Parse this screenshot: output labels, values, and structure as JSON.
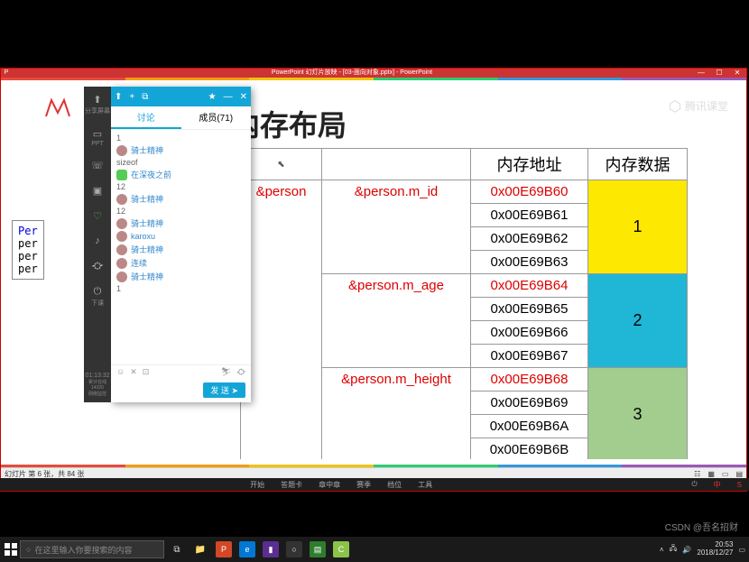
{
  "window": {
    "title": "PowerPoint 幻灯片放映 - [03-面向对象.pptx] - PowerPoint"
  },
  "slide": {
    "title": "内存布局",
    "watermark": "腾讯课堂",
    "snippet": {
      "l1a": "Per",
      "l2a": "per",
      "l3a": "per",
      "l4a": "per"
    }
  },
  "table": {
    "h_addr": "内存地址",
    "h_data": "内存数据",
    "person": "&person",
    "fields": [
      "&person.m_id",
      "&person.m_age",
      "&person.m_height"
    ],
    "addrs": [
      "0x00E69B60",
      "0x00E69B61",
      "0x00E69B62",
      "0x00E69B63",
      "0x00E69B64",
      "0x00E69B65",
      "0x00E69B66",
      "0x00E69B67",
      "0x00E69B68",
      "0x00E69B69",
      "0x00E69B6A",
      "0x00E69B6B"
    ],
    "vals": [
      "1",
      "2",
      "3"
    ],
    "cursor": "⬉"
  },
  "chat": {
    "tabs": {
      "share": "分享屏幕",
      "discuss": "讨论",
      "members": "成员(71)"
    },
    "messages": [
      {
        "n": "",
        "t": "1",
        "avatar": false
      },
      {
        "n": "骑士精神",
        "t": "",
        "avatar": true
      },
      {
        "n": "",
        "t": "sizeof",
        "avatar": false
      },
      {
        "n": "在深夜之前",
        "t": "",
        "avatar": true,
        "green": true
      },
      {
        "n": "",
        "t": "12",
        "avatar": false
      },
      {
        "n": "骑士精神",
        "t": "",
        "avatar": true
      },
      {
        "n": "",
        "t": "12",
        "avatar": false
      },
      {
        "n": "骑士精神",
        "t": "",
        "avatar": true
      },
      {
        "n": "karoxu",
        "t": "",
        "avatar": true
      },
      {
        "n": "骑士精神",
        "t": "",
        "avatar": true
      },
      {
        "n": "连续",
        "t": "",
        "avatar": true
      },
      {
        "n": "骑士精神",
        "t": "",
        "avatar": true
      },
      {
        "n": "",
        "t": "1",
        "avatar": false
      }
    ],
    "send": "发 送"
  },
  "sidebar": {
    "items": [
      "PPT",
      "语音",
      "视频",
      "录制",
      "音乐",
      "设置",
      "下课"
    ],
    "time": "01:13:32",
    "sub": "累计在线\n14320\n网络监控"
  },
  "status": {
    "left": "幻灯片 第 6 张，共 84 张"
  },
  "menu": {
    "items": [
      "开始",
      "答题卡",
      "章中章",
      "赛季",
      "档位",
      "工具"
    ]
  },
  "taskbar": {
    "search": "在这里输入你要搜索的内容",
    "time": "20:53",
    "date": "2018/12/27"
  },
  "csdn": "CSDN @吾名招财",
  "icons": {
    "send": "➤",
    "x": "✕",
    "smile": "☺",
    "image": "⊡",
    "gear": "⛮",
    "people": "⛷",
    "upload": "⬆",
    "plus": "+",
    "new": "⧉",
    "star": "★",
    "min": "—",
    "max": "☐"
  }
}
